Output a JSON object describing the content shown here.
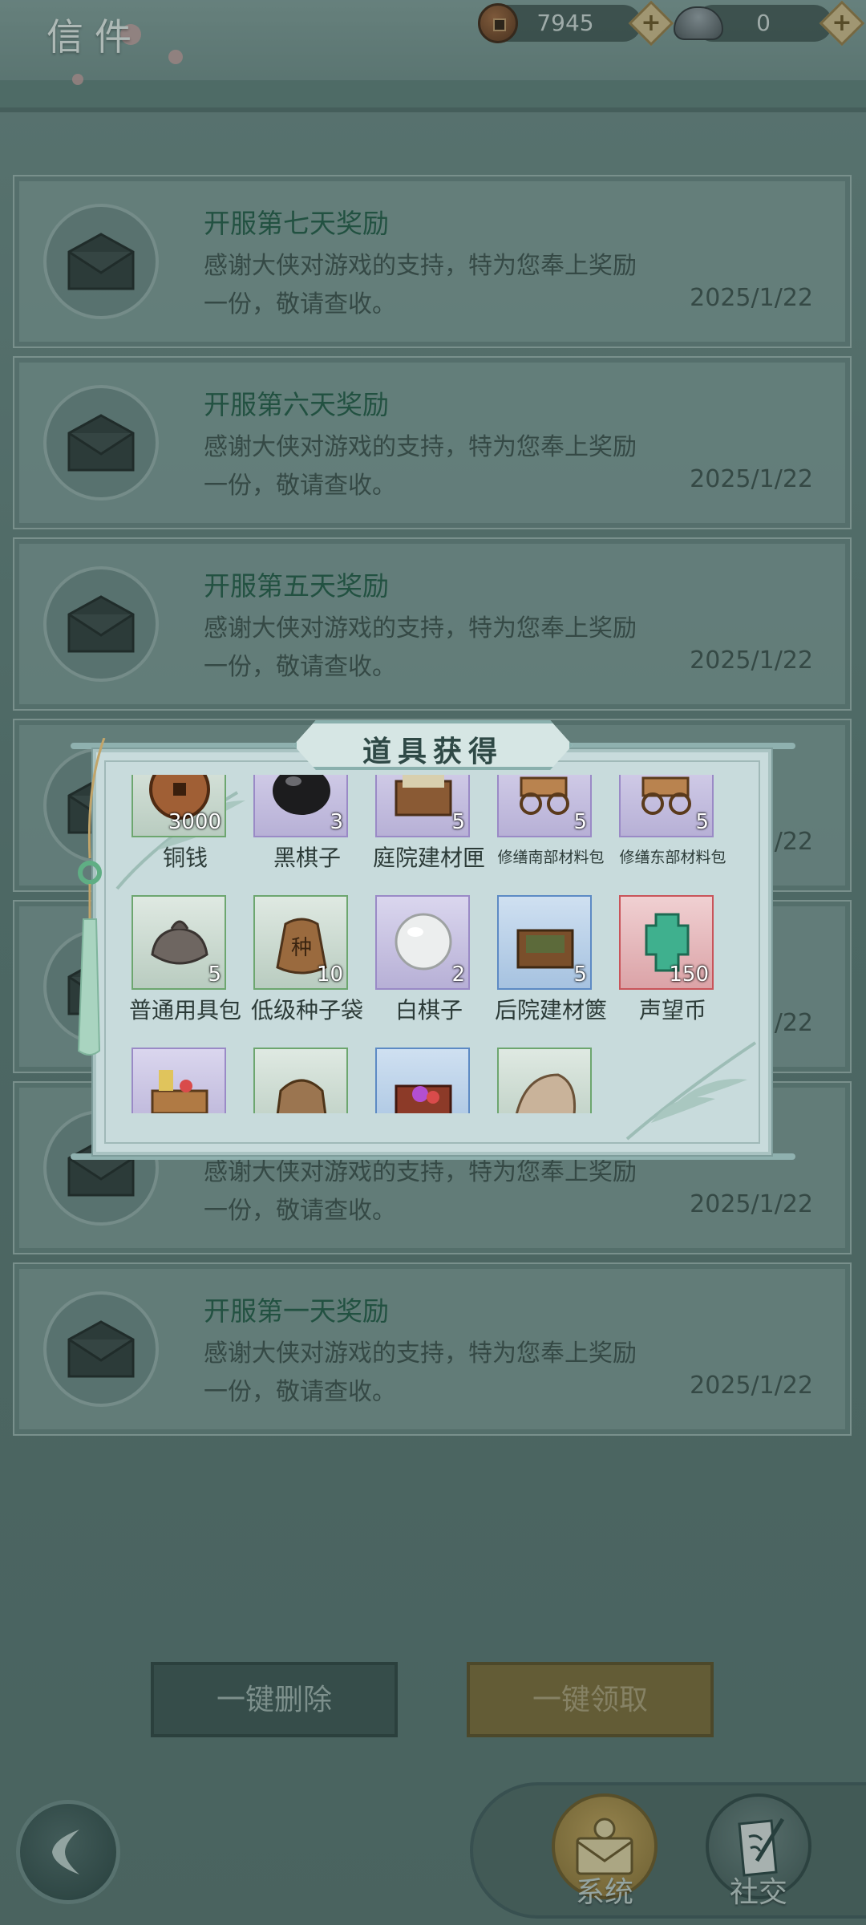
{
  "header": {
    "title": "信件",
    "copper": {
      "value": "7945",
      "plus": "+"
    },
    "ingot": {
      "value": "0",
      "plus": "+"
    }
  },
  "mails": [
    {
      "subject": "开服第七天奖励",
      "body": "感谢大侠对游戏的支持，特为您奉上奖励一份，敬请查收。",
      "date": "2025/1/22"
    },
    {
      "subject": "开服第六天奖励",
      "body": "感谢大侠对游戏的支持，特为您奉上奖励一份，敬请查收。",
      "date": "2025/1/22"
    },
    {
      "subject": "开服第五天奖励",
      "body": "感谢大侠对游戏的支持，特为您奉上奖励一份，敬请查收。",
      "date": "2025/1/22"
    },
    {
      "subject": "",
      "body": "",
      "date": "2025/1/22"
    },
    {
      "subject": "",
      "body": "",
      "date": "2025/1/22"
    },
    {
      "subject": "",
      "body": "感谢大侠对游戏的支持，特为您奉上奖励一份，敬请查收。",
      "date": "2025/1/22"
    },
    {
      "subject": "开服第一天奖励",
      "body": "感谢大侠对游戏的支持，特为您奉上奖励一份，敬请查收。",
      "date": "2025/1/22"
    }
  ],
  "actions": {
    "delete_all": "一键删除",
    "claim_all": "一键领取"
  },
  "nav": {
    "system": "系统",
    "social": "社交"
  },
  "popup": {
    "title": "道具获得",
    "items": [
      {
        "name": "铜钱",
        "qty": "3000",
        "rarity": "green",
        "icon": "copper-coin-icon"
      },
      {
        "name": "黑棋子",
        "qty": "3",
        "rarity": "purple",
        "icon": "black-go-stone-icon"
      },
      {
        "name": "庭院建材匣",
        "qty": "5",
        "rarity": "purple",
        "icon": "material-box-icon"
      },
      {
        "name": "修缮南部材料包",
        "qty": "5",
        "rarity": "purple",
        "icon": "cart-icon"
      },
      {
        "name": "修缮东部材料包",
        "qty": "5",
        "rarity": "purple",
        "icon": "cart-icon"
      },
      {
        "name": "普通用具包",
        "qty": "5",
        "rarity": "green",
        "icon": "cloth-bundle-icon"
      },
      {
        "name": "低级种子袋",
        "qty": "10",
        "rarity": "green",
        "icon": "seed-bag-icon",
        "bag_glyph": "种"
      },
      {
        "name": "白棋子",
        "qty": "2",
        "rarity": "purple",
        "icon": "white-go-stone-icon"
      },
      {
        "name": "后院建材篋",
        "qty": "5",
        "rarity": "blue",
        "icon": "material-chest-icon"
      },
      {
        "name": "声望币",
        "qty": "150",
        "rarity": "red",
        "icon": "jade-token-icon"
      },
      {
        "name": "",
        "qty": "",
        "rarity": "purple",
        "icon": "goods-cart-icon"
      },
      {
        "name": "",
        "qty": "",
        "rarity": "green",
        "icon": "sack-icon"
      },
      {
        "name": "",
        "qty": "",
        "rarity": "blue",
        "icon": "treasure-chest-icon"
      },
      {
        "name": "",
        "qty": "",
        "rarity": "green",
        "icon": "shell-icon"
      }
    ]
  }
}
